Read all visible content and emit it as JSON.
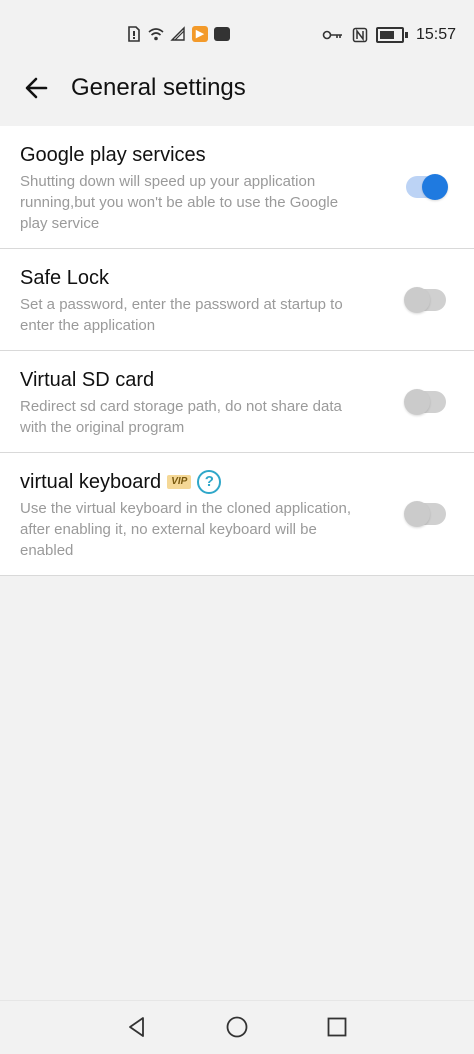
{
  "status_bar": {
    "time": "15:57",
    "icons_left": [
      "sim-alert-icon",
      "wifi-icon",
      "signal-icon",
      "app-orange-icon",
      "app-dark-icon"
    ],
    "icons_right": [
      "key-icon",
      "nfc-icon",
      "battery-icon"
    ]
  },
  "header": {
    "title": "General settings",
    "back_icon": "arrow-left-icon"
  },
  "settings": [
    {
      "title": "Google play services",
      "description": "Shutting down will speed up your application running,but you won't be able to use the Google play service",
      "enabled": true
    },
    {
      "title": "Safe Lock",
      "description": "Set a password, enter the password at startup to enter the application",
      "enabled": false
    },
    {
      "title": "Virtual SD card",
      "description": "Redirect sd card storage path, do not share data with the original program",
      "enabled": false
    },
    {
      "title": "virtual keyboard",
      "badge": "VIP",
      "help": "?",
      "description": "Use the virtual keyboard in the cloned application, after enabling it, no external keyboard will be enabled",
      "enabled": false
    }
  ],
  "colors": {
    "accent": "#1f7ae0",
    "toggle_on_track": "#bcd3f5",
    "toggle_off": "#cbcbcb",
    "help": "#2fa7c9",
    "vip_badge": "#f5d896"
  },
  "navigation": {
    "back": "triangle-back-icon",
    "home": "circle-home-icon",
    "recents": "square-recents-icon"
  }
}
